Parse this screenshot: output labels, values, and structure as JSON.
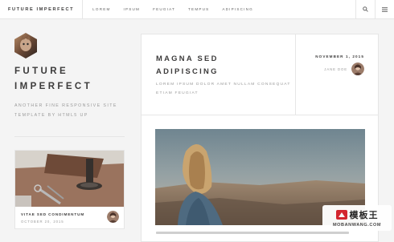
{
  "navbar": {
    "brand": "FUTURE IMPERFECT",
    "links": [
      "LOREM",
      "IPSUM",
      "FEUGIAT",
      "TEMPUS",
      "ADIPISCING"
    ],
    "search_icon": "search-icon",
    "menu_icon": "menu-icon"
  },
  "intro": {
    "title_line1": "FUTURE",
    "title_line2": "IMPERFECT",
    "tagline_line1": "ANOTHER FINE RESPONSIVE SITE",
    "tagline_line2": "TEMPLATE BY HTML5 UP"
  },
  "mini_post": {
    "title": "VITAE SED CONDIMENTUM",
    "date": "OCTOBER 20, 2015"
  },
  "post": {
    "title_line1": "MAGNA SED",
    "title_line2": "ADIPISCING",
    "subtitle_line1": "LOREM IPSUM DOLOR AMET NULLAM CONSEQUAT",
    "subtitle_line2": "ETIAM FEUGIAT",
    "date": "NOVEMBER 1, 2015",
    "author": "JANE DOE"
  },
  "watermark": {
    "chinese": "模板王",
    "url": "MOBANWANG.COM"
  },
  "colors": {
    "background": "#f4f4f4",
    "card": "#ffffff",
    "border": "#e6e6e6",
    "heading": "#3c3b3b",
    "muted": "#9a9a9a"
  }
}
